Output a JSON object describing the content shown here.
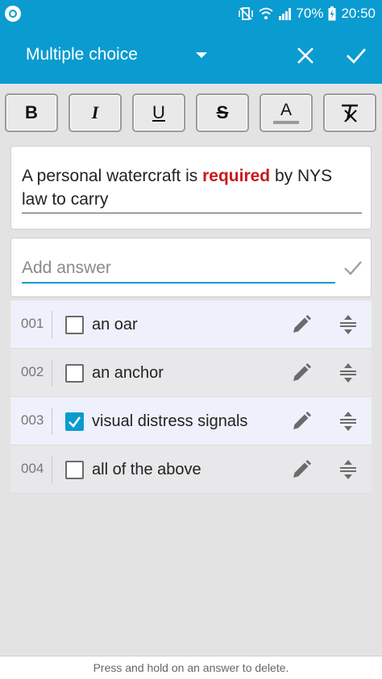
{
  "status_bar": {
    "battery": "70%",
    "time": "20:50",
    "icons": [
      "app-notification-icon",
      "vibrate-icon",
      "wifi-icon",
      "signal-icon",
      "battery-charging-icon"
    ]
  },
  "app_bar": {
    "title": "Multiple choice",
    "icons": [
      "dropdown-arrow-icon",
      "close-icon",
      "check-icon"
    ],
    "accent_color": "#0a9bd0"
  },
  "toolbar": {
    "bold": "B",
    "italic": "I",
    "underline": "U",
    "strike": "S",
    "color": "A",
    "clear_format_icon": "clear-format-icon"
  },
  "question": {
    "text_before": "A personal watercraft is ",
    "text_highlight": "required",
    "text_after": " by NYS law to carry",
    "highlight_color": "#c8191b"
  },
  "add_answer": {
    "placeholder": "Add answer",
    "value": ""
  },
  "answers": [
    {
      "number": "001",
      "label": "an oar",
      "checked": false
    },
    {
      "number": "002",
      "label": "an anchor",
      "checked": false
    },
    {
      "number": "003",
      "label": "visual distress signals",
      "checked": true
    },
    {
      "number": "004",
      "label": "all of the above",
      "checked": false
    }
  ],
  "footer": {
    "hint": "Press and hold on an answer to delete."
  }
}
